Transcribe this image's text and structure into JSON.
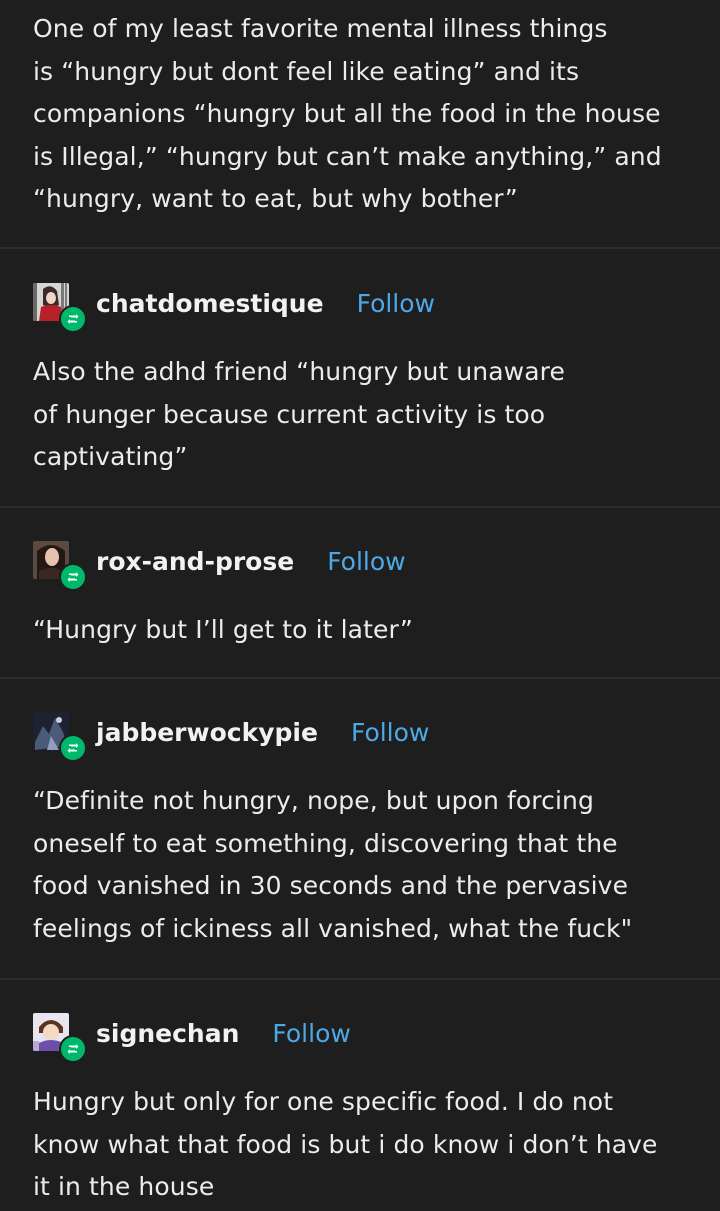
{
  "posts": [
    {
      "body": "One of my least favorite mental illness things\nis “hungry but dont feel like eating” and its\ncompanions “hungry but all the food in the house\nis Illegal,” “hungry but can’t make anything,” and\n“hungry, want to eat, but why bother”"
    },
    {
      "username": "chatdomestique",
      "follow_label": "Follow",
      "body": "Also the adhd friend “hungry but unaware\nof hunger because current activity is too\ncaptivating”"
    },
    {
      "username": "rox-and-prose",
      "follow_label": "Follow",
      "body": "“Hungry but I’ll get to it later”"
    },
    {
      "username": "jabberwockypie",
      "follow_label": "Follow",
      "body": "“Definite not hungry, nope, but upon forcing\noneself to eat something, discovering that the\nfood vanished in 30 seconds and the pervasive\nfeelings of ickiness all vanished, what the fuck\""
    },
    {
      "username": "signechan",
      "follow_label": "Follow",
      "body": "Hungry but only for one specific food. I do not\nknow what that food is but i do know i don’t have\nit in the house"
    }
  ],
  "icons": {
    "reblog": "reblog-icon"
  },
  "colors": {
    "background": "#1e1e1e",
    "follow_link": "#4da8e6",
    "reblog_badge": "#00b86b",
    "text": "#ececec"
  }
}
